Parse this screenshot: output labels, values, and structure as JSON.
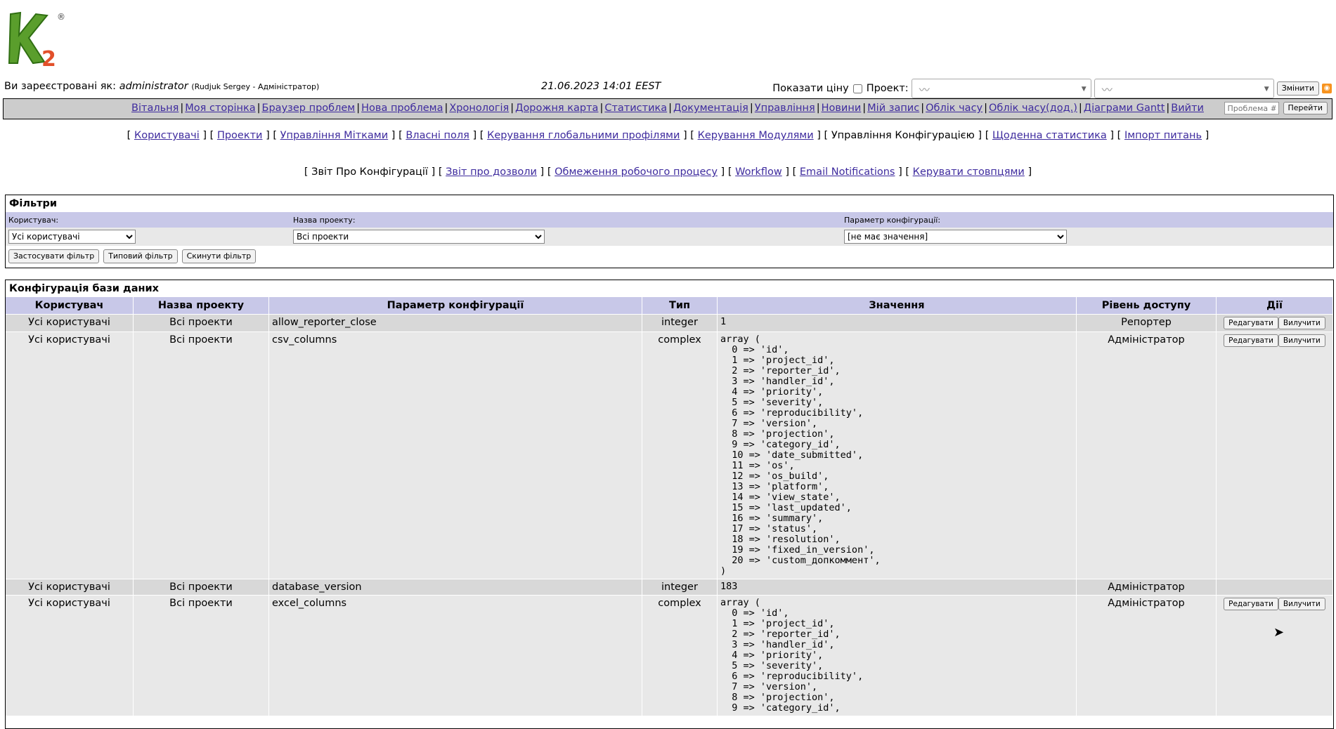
{
  "header": {
    "logo_text": "K",
    "logo_sub": "2",
    "logo_reg": "®",
    "logged_in_label": "Ви зареєстровані як:",
    "username": "administrator",
    "user_detail": "(Rudjuk Sergey - Адміністратор)",
    "datetime": "21.06.2023 14:01 EEST",
    "show_price_label": "Показати ціну",
    "project_label": "Проект:",
    "change_button": "Змінити"
  },
  "menu": {
    "items": [
      "Вітальня",
      "Моя сторінка",
      "Браузер проблем",
      "Нова проблема",
      "Хронологія",
      "Дорожня карта",
      "Статистика",
      "Документація",
      "Управління",
      "Новини",
      "Мій запис",
      "Облік часу",
      "Облік часу(дод.)",
      "Діаграми Gantt",
      "Вийти"
    ],
    "issue_placeholder": "Проблема #",
    "go_button": "Перейти"
  },
  "submenu1": {
    "items": [
      "Користувачі",
      "Проекти",
      "Управління Мітками",
      "Власні поля",
      "Керування глобальними профілями",
      "Керування Модулями",
      "Управління Конфігурацією",
      "Щоденна статистика",
      "Імпорт питань"
    ],
    "current": "Управління Конфігурацією"
  },
  "submenu2": {
    "items": [
      "Звіт Про Конфігурації",
      "Звіт про дозволи",
      "Обмеження робочого процесу",
      "Workflow",
      "Email Notifications",
      "Керувати стовпцями"
    ],
    "current": "Звіт Про Конфігурації"
  },
  "filters": {
    "title": "Фільтри",
    "user_label": "Користувач:",
    "project_label": "Назва проекту:",
    "param_label": "Параметр конфігурації:",
    "user_value": "Усі користувачі",
    "project_value": "Всі проекти",
    "param_value": "[не має значення]",
    "apply_button": "Застосувати фільтр",
    "default_button": "Типовий фільтр",
    "reset_button": "Скинути фільтр"
  },
  "config": {
    "title": "Конфігурація бази даних",
    "columns": [
      "Користувач",
      "Назва проекту",
      "Параметр конфігурації",
      "Тип",
      "Значення",
      "Рівень доступу",
      "Дії"
    ],
    "edit_button": "Редагувати",
    "delete_button": "Вилучити",
    "rows": [
      {
        "user": "Усі користувачі",
        "project": "Всі проекти",
        "param": "allow_reporter_close",
        "type": "integer",
        "value": "1",
        "access": "Репортер",
        "actions": true
      },
      {
        "user": "Усі користувачі",
        "project": "Всі проекти",
        "param": "csv_columns",
        "type": "complex",
        "value": "array (\n  0 => 'id',\n  1 => 'project_id',\n  2 => 'reporter_id',\n  3 => 'handler_id',\n  4 => 'priority',\n  5 => 'severity',\n  6 => 'reproducibility',\n  7 => 'version',\n  8 => 'projection',\n  9 => 'category_id',\n  10 => 'date_submitted',\n  11 => 'os',\n  12 => 'os_build',\n  13 => 'platform',\n  14 => 'view_state',\n  15 => 'last_updated',\n  16 => 'summary',\n  17 => 'status',\n  18 => 'resolution',\n  19 => 'fixed_in_version',\n  20 => 'custom_допкоммент',\n)",
        "access": "Адміністратор",
        "actions": true
      },
      {
        "user": "Усі користувачі",
        "project": "Всі проекти",
        "param": "database_version",
        "type": "integer",
        "value": "183",
        "access": "Адміністратор",
        "actions": false
      },
      {
        "user": "Усі користувачі",
        "project": "Всі проекти",
        "param": "excel_columns",
        "type": "complex",
        "value": "array (\n  0 => 'id',\n  1 => 'project_id',\n  2 => 'reporter_id',\n  3 => 'handler_id',\n  4 => 'priority',\n  5 => 'severity',\n  6 => 'reproducibility',\n  7 => 'version',\n  8 => 'projection',\n  9 => 'category_id',",
        "access": "Адміністратор",
        "actions": true
      }
    ]
  }
}
